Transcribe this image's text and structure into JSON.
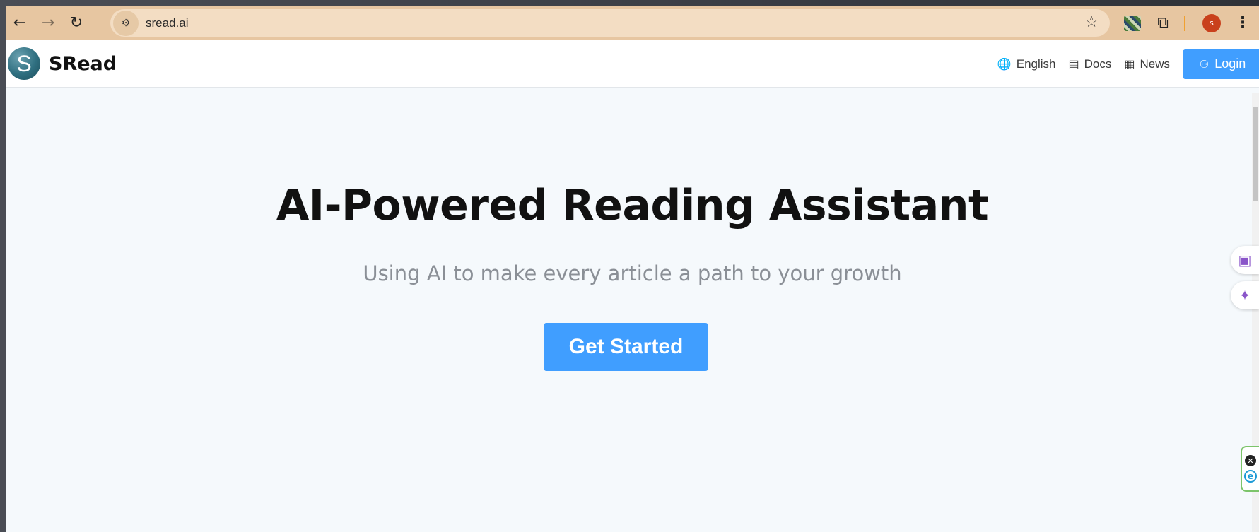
{
  "browser": {
    "url": "sread.ai",
    "profile_initial": "s",
    "icons": {
      "back": "←",
      "forward": "→",
      "reload": "↻",
      "site_info": "⚙",
      "bookmark": "☆",
      "extensions": "⧉",
      "menu": "⋮"
    }
  },
  "header": {
    "logo_letter": "S",
    "brand": "SRead",
    "nav": [
      {
        "label": "English",
        "icon": "globe-icon",
        "glyph": "🌐"
      },
      {
        "label": "Docs",
        "icon": "document-icon",
        "glyph": "▤"
      },
      {
        "label": "News",
        "icon": "newspaper-icon",
        "glyph": "▦"
      }
    ],
    "login_label": "Login",
    "login_glyph": "⚇"
  },
  "hero": {
    "title": "AI-Powered Reading Assistant",
    "subtitle": "Using AI to make every article a path to your growth",
    "cta_label": "Get Started"
  },
  "side": {
    "doc_glyph": "▣",
    "sparkle_glyph": "✦",
    "close_glyph": "✕",
    "ext_glyph": "e"
  },
  "colors": {
    "toolbar": "#e7c6a1",
    "accent": "#409eff",
    "page_bg": "#f5f9fc",
    "subtitle": "#8a8f96"
  }
}
